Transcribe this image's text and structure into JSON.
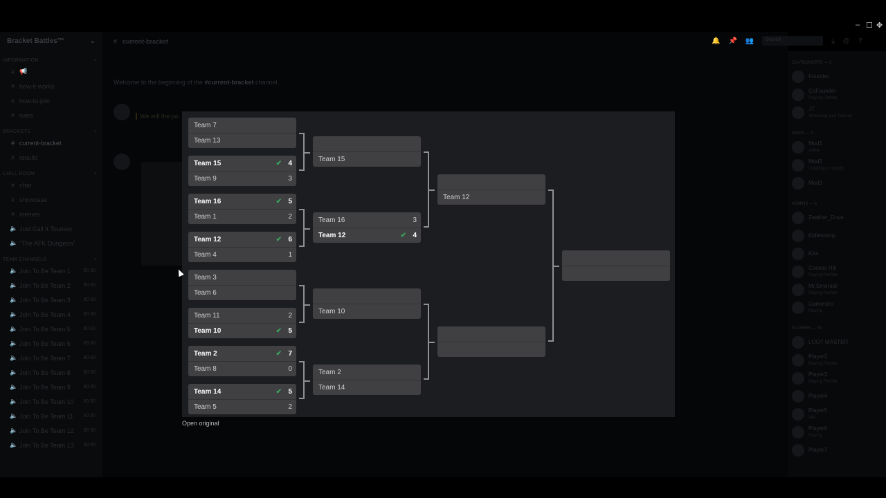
{
  "window": {
    "minimize": "–",
    "maximize": "☐",
    "move": "✥"
  },
  "server": {
    "name": "Bracket Battles™",
    "chevron": "⌄",
    "categories": [
      {
        "name": "Information",
        "channels": [
          {
            "icon": "hash-icon",
            "label": "📢"
          },
          {
            "icon": "hash-icon",
            "label": "how-it-works"
          },
          {
            "icon": "hash-icon",
            "label": "how-to-join"
          },
          {
            "icon": "hash-icon",
            "label": "rules"
          }
        ]
      },
      {
        "name": "Brackets",
        "channels": [
          {
            "icon": "hash-icon",
            "label": "current-bracket",
            "active": true
          },
          {
            "icon": "hash-icon",
            "label": "results"
          }
        ]
      },
      {
        "name": "Chill Room",
        "channels": [
          {
            "icon": "hash-icon",
            "label": "chat"
          },
          {
            "icon": "hash-icon",
            "label": "showcase"
          },
          {
            "icon": "hash-icon",
            "label": "memes"
          },
          {
            "icon": "speaker-icon",
            "label": "Just Call It Tourney"
          },
          {
            "icon": "speaker-icon",
            "label": "\"The AFK Dungeon\""
          }
        ]
      },
      {
        "name": "Team Channels",
        "channels": [
          {
            "icon": "speaker-icon",
            "label": "Join To Be Team 1",
            "count": "00  00"
          },
          {
            "icon": "speaker-icon",
            "label": "Join To Be Team 2",
            "count": "00  00"
          },
          {
            "icon": "speaker-icon",
            "label": "Join To Be Team 3",
            "count": "00  00"
          },
          {
            "icon": "speaker-icon",
            "label": "Join To Be Team 4",
            "count": "00  00"
          },
          {
            "icon": "speaker-icon",
            "label": "Join To Be Team 5",
            "count": "00  00"
          },
          {
            "icon": "speaker-icon",
            "label": "Join To Be Team 6",
            "count": "00  00"
          },
          {
            "icon": "speaker-icon",
            "label": "Join To Be Team 7",
            "count": "00  00"
          },
          {
            "icon": "speaker-icon",
            "label": "Join To Be Team 8",
            "count": "00  00"
          },
          {
            "icon": "speaker-icon",
            "label": "Join To Be Team 9",
            "count": "00  00"
          },
          {
            "icon": "speaker-icon",
            "label": "Join To Be Team 10",
            "count": "00  00"
          },
          {
            "icon": "speaker-icon",
            "label": "Join To Be Team 11",
            "count": "00  00"
          },
          {
            "icon": "speaker-icon",
            "label": "Join To Be Team 12",
            "count": "00  00"
          },
          {
            "icon": "speaker-icon",
            "label": "Join To Be Team 13",
            "count": "00  00"
          }
        ]
      }
    ]
  },
  "chat": {
    "channel_name": "current-bracket",
    "search_placeholder": "Search",
    "welcome_prefix": "Welcome to the beginning of the ",
    "welcome_channel": "#current-bracket",
    "welcome_suffix": " channel.",
    "message_preview": "We will the po"
  },
  "members": {
    "groups": [
      {
        "name": "Co-Founders — 3",
        "members": [
          {
            "name": "Founder",
            "status": ""
          },
          {
            "name": "CoFounder",
            "status": "Playing Fortnite"
          },
          {
            "name": "JT",
            "status": "Streaming Just Tourney"
          }
        ]
      },
      {
        "name": "Mods — 3",
        "members": [
          {
            "name": "Mod1",
            "status": "online"
          },
          {
            "name": "Mod2",
            "status": "Listening to Spotify"
          },
          {
            "name": "Mod3",
            "status": ""
          }
        ]
      },
      {
        "name": "Admins — 6",
        "members": [
          {
            "name": "Zeather_Dove",
            "status": ""
          },
          {
            "name": "Kidlestomp",
            "status": ""
          },
          {
            "name": "Kira",
            "status": ""
          },
          {
            "name": "Cosmic Hill",
            "status": "Playing Fortnite"
          },
          {
            "name": "Mr.Emerald",
            "status": "Playing Fortnite"
          },
          {
            "name": "Gamerpro",
            "status": "Playing"
          }
        ]
      },
      {
        "name": "Players — 30",
        "members": [
          {
            "name": "LOOT MASTER",
            "status": ""
          },
          {
            "name": "Player2",
            "status": "Playing Fortnite"
          },
          {
            "name": "Player3",
            "status": "Playing Fortnite"
          },
          {
            "name": "Player4",
            "status": ""
          },
          {
            "name": "Player5",
            "status": "Idle"
          },
          {
            "name": "Player6",
            "status": "Playing"
          },
          {
            "name": "Player7",
            "status": ""
          }
        ]
      }
    ]
  },
  "bracket": {
    "open_original": "Open original",
    "check_color": "#3ba55c",
    "round1": [
      {
        "teams": [
          {
            "name": "Team 7",
            "score": "",
            "win": false
          },
          {
            "name": "Team 13",
            "score": "",
            "win": false
          }
        ]
      },
      {
        "teams": [
          {
            "name": "Team 15",
            "score": "4",
            "win": true
          },
          {
            "name": "Team 9",
            "score": "3",
            "win": false
          }
        ]
      },
      {
        "teams": [
          {
            "name": "Team 16",
            "score": "5",
            "win": true
          },
          {
            "name": "Team 1",
            "score": "2",
            "win": false
          }
        ]
      },
      {
        "teams": [
          {
            "name": "Team 12",
            "score": "6",
            "win": true
          },
          {
            "name": "Team 4",
            "score": "1",
            "win": false
          }
        ]
      },
      {
        "teams": [
          {
            "name": "Team 3",
            "score": "",
            "win": false
          },
          {
            "name": "Team 6",
            "score": "",
            "win": false
          }
        ]
      },
      {
        "teams": [
          {
            "name": "Team 11",
            "score": "2",
            "win": false
          },
          {
            "name": "Team 10",
            "score": "5",
            "win": true
          }
        ]
      },
      {
        "teams": [
          {
            "name": "Team 2",
            "score": "7",
            "win": true
          },
          {
            "name": "Team 8",
            "score": "0",
            "win": false
          }
        ]
      },
      {
        "teams": [
          {
            "name": "Team 14",
            "score": "5",
            "win": true
          },
          {
            "name": "Team 5",
            "score": "2",
            "win": false
          }
        ]
      }
    ],
    "round2": [
      {
        "teams": [
          {
            "name": "",
            "score": "",
            "win": false
          },
          {
            "name": "Team 15",
            "score": "",
            "win": false
          }
        ]
      },
      {
        "teams": [
          {
            "name": "Team 16",
            "score": "3",
            "win": false
          },
          {
            "name": "Team 12",
            "score": "4",
            "win": true
          }
        ]
      },
      {
        "teams": [
          {
            "name": "",
            "score": "",
            "win": false
          },
          {
            "name": "Team 10",
            "score": "",
            "win": false
          }
        ]
      },
      {
        "teams": [
          {
            "name": "Team 2",
            "score": "",
            "win": false
          },
          {
            "name": "Team 14",
            "score": "",
            "win": false
          }
        ]
      }
    ],
    "round3": [
      {
        "teams": [
          {
            "name": "",
            "score": "",
            "win": false
          },
          {
            "name": "Team 12",
            "score": "",
            "win": false
          }
        ]
      },
      {
        "teams": [
          {
            "name": "",
            "score": "",
            "win": false
          },
          {
            "name": "",
            "score": "",
            "win": false
          }
        ]
      }
    ],
    "final": [
      {
        "teams": [
          {
            "name": "",
            "score": "",
            "win": false
          },
          {
            "name": "",
            "score": "",
            "win": false
          }
        ]
      }
    ]
  }
}
